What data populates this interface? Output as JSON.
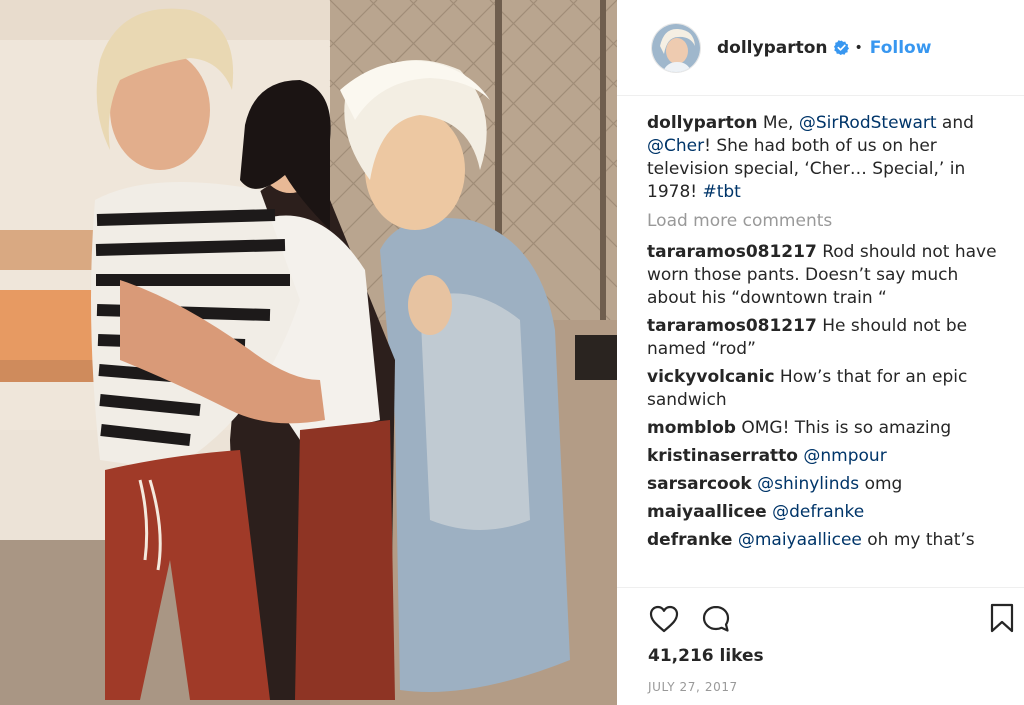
{
  "post": {
    "photo": {
      "subject": "three-people-hugging-photo"
    },
    "header": {
      "username": "dollyparton",
      "verified_icon": "verified-badge-icon",
      "separator": "•",
      "follow_label": "Follow",
      "accent_color": "#3897f0"
    },
    "caption": {
      "username": "dollyparton",
      "text_1": " Me, ",
      "mention_1": "@SirRodStewart",
      "text_2": " and ",
      "mention_2": "@Cher",
      "text_3": "! She had both of us on her television special, ‘Cher… Special,’ in 1978! ",
      "hashtag": "#tbt"
    },
    "load_more_label": "Load more comments",
    "comments": [
      {
        "username": "tararamos081217",
        "text": " Rod should not have worn those pants. Doesn’t say much about his “downtown train “"
      },
      {
        "username": "tararamos081217",
        "text": " He should not be named “rod”"
      },
      {
        "username": "vickyvolcanic",
        "text": " How’s that for an epic sandwich"
      },
      {
        "username": "momblob",
        "text": " OMG! This is so amazing"
      },
      {
        "username": "kristinaserratto",
        "mention": "@nmpour",
        "text": ""
      },
      {
        "username": "sarsarcook",
        "mention": "@shinylinds",
        "text": " omg"
      },
      {
        "username": "maiyaallicee",
        "mention": "@defranke",
        "text": ""
      },
      {
        "username": "defranke",
        "mention": "@maiyaallicee",
        "text": " oh my that’s"
      }
    ],
    "footer": {
      "like_icon": "heart-icon",
      "comment_icon": "comment-icon",
      "save_icon": "bookmark-icon",
      "likes": "41,216 likes",
      "date": "JULY 27, 2017"
    }
  }
}
